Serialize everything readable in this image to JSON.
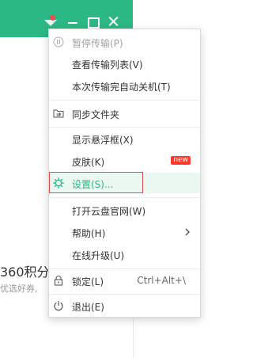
{
  "background": {
    "points_text": "360积分",
    "hint_text": "优选好券,"
  },
  "titlebar": {
    "accent_color": "#2cb884",
    "buttons": [
      "skin-icon",
      "minimize-icon",
      "maximize-icon",
      "close-icon"
    ]
  },
  "menu": {
    "items": [
      {
        "label": "暂停传输(P)",
        "icon": "pause-icon",
        "disabled": true
      },
      {
        "label": "查看传输列表(V)"
      },
      {
        "label": "本次传输完自动关机(T)"
      },
      {
        "label": "同步文件夹",
        "icon": "sync-folder-icon"
      },
      {
        "label": "显示悬浮框(X)"
      },
      {
        "label": "皮肤(K)",
        "badge": "new"
      },
      {
        "label": "设置(S)...",
        "icon": "settings-gear-icon",
        "highlighted": true
      },
      {
        "label": "打开云盘官网(W)"
      },
      {
        "label": "帮助(H)",
        "submenu": true
      },
      {
        "label": "在线升级(U)"
      },
      {
        "label": "锁定(L)",
        "icon": "lock-icon",
        "shortcut": "Ctrl+Alt+\\"
      },
      {
        "label": "退出(E)",
        "icon": "power-icon"
      }
    ]
  }
}
